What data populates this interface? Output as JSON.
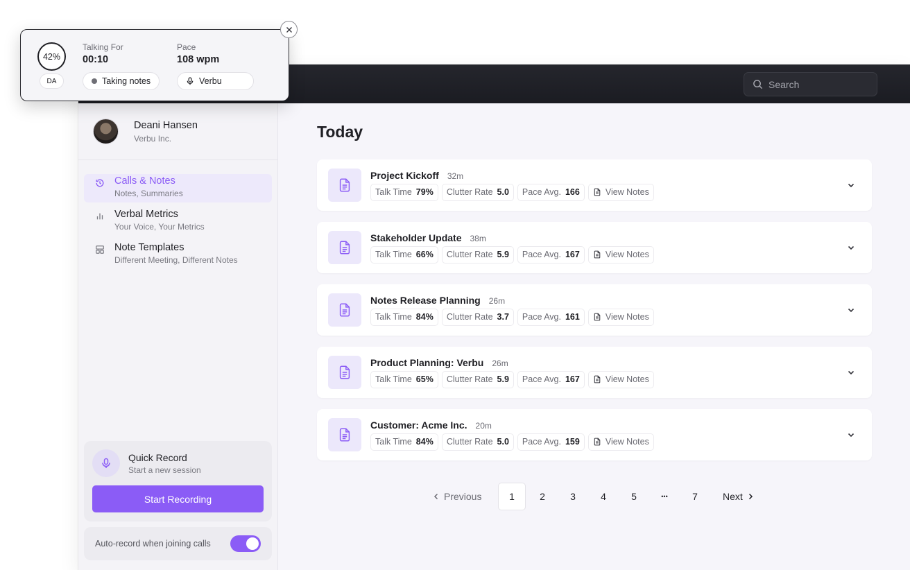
{
  "search": {
    "placeholder": "Search"
  },
  "profile": {
    "name": "Deani Hansen",
    "org": "Verbu Inc."
  },
  "nav": [
    {
      "title": "Calls & Notes",
      "subtitle": "Notes, Summaries",
      "icon": "history-icon",
      "active": true
    },
    {
      "title": "Verbal Metrics",
      "subtitle": "Your Voice, Your Metrics",
      "icon": "bar-chart-icon",
      "active": false
    },
    {
      "title": "Note Templates",
      "subtitle": "Different Meeting, Different Notes",
      "icon": "layout-icon",
      "active": false
    }
  ],
  "quick_record": {
    "title": "Quick Record",
    "subtitle": "Start a new session",
    "button": "Start Recording"
  },
  "auto_record": {
    "label": "Auto-record when joining calls",
    "enabled": true
  },
  "main": {
    "title": "Today",
    "labels": {
      "talk_time": "Talk Time",
      "clutter_rate": "Clutter Rate",
      "pace_avg": "Pace Avg.",
      "view_notes": "View Notes"
    },
    "calls": [
      {
        "title": "Project Kickoff",
        "duration": "32m",
        "talk_time": "79%",
        "clutter_rate": "5.0",
        "pace_avg": "166"
      },
      {
        "title": "Stakeholder Update",
        "duration": "38m",
        "talk_time": "66%",
        "clutter_rate": "5.9",
        "pace_avg": "167"
      },
      {
        "title": "Notes Release Planning",
        "duration": "26m",
        "talk_time": "84%",
        "clutter_rate": "3.7",
        "pace_avg": "161"
      },
      {
        "title": "Product Planning: Verbu",
        "duration": "26m",
        "talk_time": "65%",
        "clutter_rate": "5.9",
        "pace_avg": "167"
      },
      {
        "title": "Customer: Acme Inc.",
        "duration": "20m",
        "talk_time": "84%",
        "clutter_rate": "5.0",
        "pace_avg": "159"
      }
    ]
  },
  "pagination": {
    "previous": "Previous",
    "next": "Next",
    "pages": [
      "1",
      "2",
      "3",
      "4",
      "5",
      "•••",
      "7"
    ],
    "current": "1"
  },
  "widget": {
    "percent": "42%",
    "initials": "DA",
    "talking_label": "Talking For",
    "talking_value": "00:10",
    "pace_label": "Pace",
    "pace_value": "108 wpm",
    "status": "Taking notes",
    "mic_source": "Verbu"
  },
  "colors": {
    "accent": "#8b5cf6",
    "topbar": "#1f2026"
  }
}
